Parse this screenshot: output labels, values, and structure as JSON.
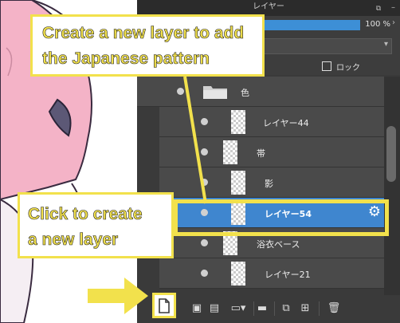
{
  "panel": {
    "title": "レイヤー",
    "opacity_value": "100 %",
    "opacity_level": 1.0,
    "lock_label": "ロック"
  },
  "layers": [
    {
      "name": "色",
      "type": "folder"
    },
    {
      "name": "レイヤー44",
      "type": "layer"
    },
    {
      "name": "帯",
      "type": "layer"
    },
    {
      "name": "影",
      "type": "layer"
    },
    {
      "name": "レイヤー54",
      "type": "layer",
      "selected": true
    },
    {
      "name": "浴衣ベース",
      "type": "layer"
    },
    {
      "name": "レイヤー21",
      "type": "layer"
    }
  ],
  "toolbar": {
    "icons": [
      "new-layer-icon",
      "new-layer-8bit-icon",
      "new-layer-1bit-icon",
      "add-layer-menu-icon",
      "folder-icon",
      "duplicate-icon",
      "merge-icon",
      "delete-icon"
    ]
  },
  "callouts": {
    "top_line1": "Create a new layer to add",
    "top_line2": "the Japanese pattern",
    "left_line1": "Click to create",
    "left_line2": "a new layer"
  },
  "colors": {
    "accent": "#f2e14c",
    "selection": "#3f86cf",
    "panel_bg": "#3a3a3a"
  }
}
